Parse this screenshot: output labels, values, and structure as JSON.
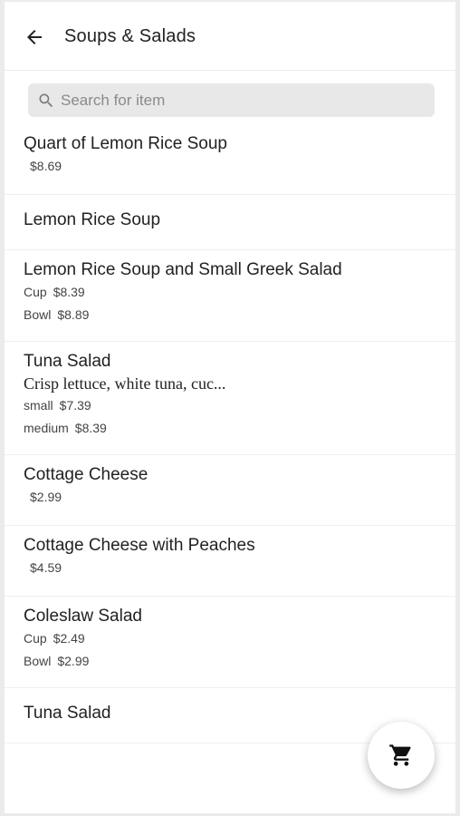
{
  "header": {
    "title": "Soups & Salads",
    "back_icon": "arrow-left-icon"
  },
  "search": {
    "placeholder": "Search for item",
    "value": "",
    "icon": "search-icon"
  },
  "items": [
    {
      "name": "Quart of Lemon Rice Soup",
      "description": "",
      "prices": [
        {
          "label": "",
          "price": "$8.69"
        }
      ]
    },
    {
      "name": "Lemon Rice Soup",
      "description": "",
      "prices": []
    },
    {
      "name": "Lemon Rice Soup and Small Greek Salad",
      "description": "",
      "prices": [
        {
          "label": "Cup",
          "price": "$8.39"
        },
        {
          "label": "Bowl",
          "price": "$8.89"
        }
      ]
    },
    {
      "name": "Tuna Salad",
      "description": "Crisp lettuce, white tuna, cuc...",
      "prices": [
        {
          "label": "small",
          "price": "$7.39"
        },
        {
          "label": "medium",
          "price": "$8.39"
        }
      ]
    },
    {
      "name": "Cottage Cheese",
      "description": "",
      "prices": [
        {
          "label": "",
          "price": "$2.99"
        }
      ]
    },
    {
      "name": "Cottage Cheese with Peaches",
      "description": "",
      "prices": [
        {
          "label": "",
          "price": "$4.59"
        }
      ]
    },
    {
      "name": "Coleslaw Salad",
      "description": "",
      "prices": [
        {
          "label": "Cup",
          "price": "$2.49"
        },
        {
          "label": "Bowl",
          "price": "$2.99"
        }
      ]
    },
    {
      "name": "Tuna Salad",
      "description": "",
      "prices": []
    }
  ],
  "cart_button": {
    "icon": "cart-icon"
  },
  "colors": {
    "search_bg": "#e8e8e8",
    "text": "#222222",
    "divider": "#efefef"
  }
}
